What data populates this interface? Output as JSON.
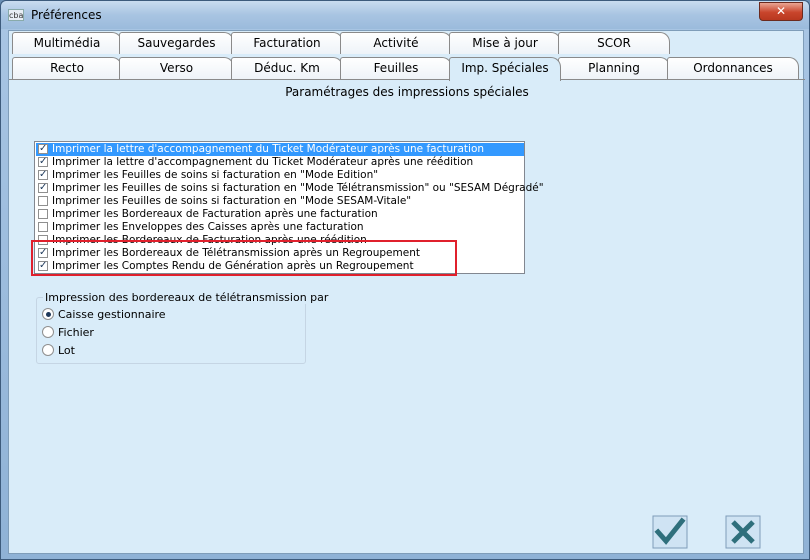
{
  "window": {
    "app_icon": "cba",
    "title": "Préférences",
    "close_label": "✕"
  },
  "tabs_row1": [
    {
      "label": "Multimédia"
    },
    {
      "label": "Sauvegardes"
    },
    {
      "label": "Facturation"
    },
    {
      "label": "Activité"
    },
    {
      "label": "Mise à jour"
    },
    {
      "label": "SCOR"
    }
  ],
  "tabs_row2": [
    {
      "label": "Recto"
    },
    {
      "label": "Verso"
    },
    {
      "label": "Déduc. Km"
    },
    {
      "label": "Feuilles"
    },
    {
      "label": "Imp. Spéciales",
      "active": true
    },
    {
      "label": "Planning"
    },
    {
      "label": "Ordonnances"
    }
  ],
  "section": {
    "title": "Paramétrages des impressions spéciales"
  },
  "options_list": [
    {
      "label": "Imprimer la lettre d'accompagnement du Ticket Modérateur après une facturation",
      "checked": true,
      "selected": true
    },
    {
      "label": "Imprimer la lettre d'accompagnement du Ticket Modérateur après une réédition",
      "checked": true
    },
    {
      "label": "Imprimer les Feuilles de soins si facturation en \"Mode Edition\"",
      "checked": true
    },
    {
      "label": "Imprimer les Feuilles de soins si facturation en \"Mode Télétransmission\" ou \"SESAM Dégradé\"",
      "checked": true
    },
    {
      "label": "Imprimer les Feuilles de soins si facturation en \"Mode SESAM-Vitale\"",
      "checked": false
    },
    {
      "label": "Imprimer les Bordereaux de Facturation après une facturation",
      "checked": false
    },
    {
      "label": "Imprimer les Enveloppes des Caisses après une facturation",
      "checked": false
    },
    {
      "label": "Imprimer les Bordereaux de Facturation après une réédition",
      "checked": false
    },
    {
      "label": "Imprimer les Bordereaux de Télétransmission après un Regroupement",
      "checked": true
    },
    {
      "label": "Imprimer les Comptes Rendu de Génération après un Regroupement",
      "checked": true
    }
  ],
  "bordereaux_group": {
    "title": "Impression des bordereaux de télétransmission par",
    "options": [
      {
        "label": "Caisse gestionnaire",
        "selected": true
      },
      {
        "label": "Fichier",
        "selected": false
      },
      {
        "label": "Lot",
        "selected": false
      }
    ]
  },
  "buttons": {
    "ok_icon": "checkmark-icon",
    "cancel_icon": "x-cross-icon"
  },
  "colors": {
    "highlight_box": "#e0202c",
    "selection": "#3399ff",
    "client_bg": "#d9ecf9"
  }
}
